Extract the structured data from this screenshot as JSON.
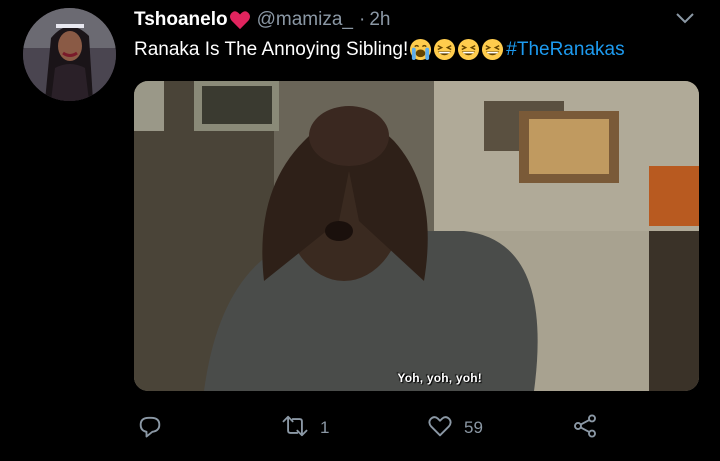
{
  "tweet": {
    "display_name": "Tshoanelo",
    "handle": "@mamiza_",
    "separator": "·",
    "time": "2h",
    "text": "Ranaka Is The Annoying Sibling!",
    "hashtag": "#TheRanakas",
    "emojis": [
      "loudly-crying-face",
      "grinning-squinting-face",
      "grinning-squinting-face",
      "grinning-squinting-face"
    ],
    "media_caption": "Yoh, yoh, yoh!"
  },
  "actions": {
    "reply_count": "",
    "retweet_count": "1",
    "like_count": "59"
  },
  "colors": {
    "background": "#000000",
    "secondary_text": "#8b98a5",
    "hashtag": "#1d9bf0",
    "heart": "#e0245e"
  },
  "icons": [
    "chevron-down-icon",
    "reply-icon",
    "retweet-icon",
    "like-icon",
    "share-icon",
    "heart-emoji-icon"
  ]
}
